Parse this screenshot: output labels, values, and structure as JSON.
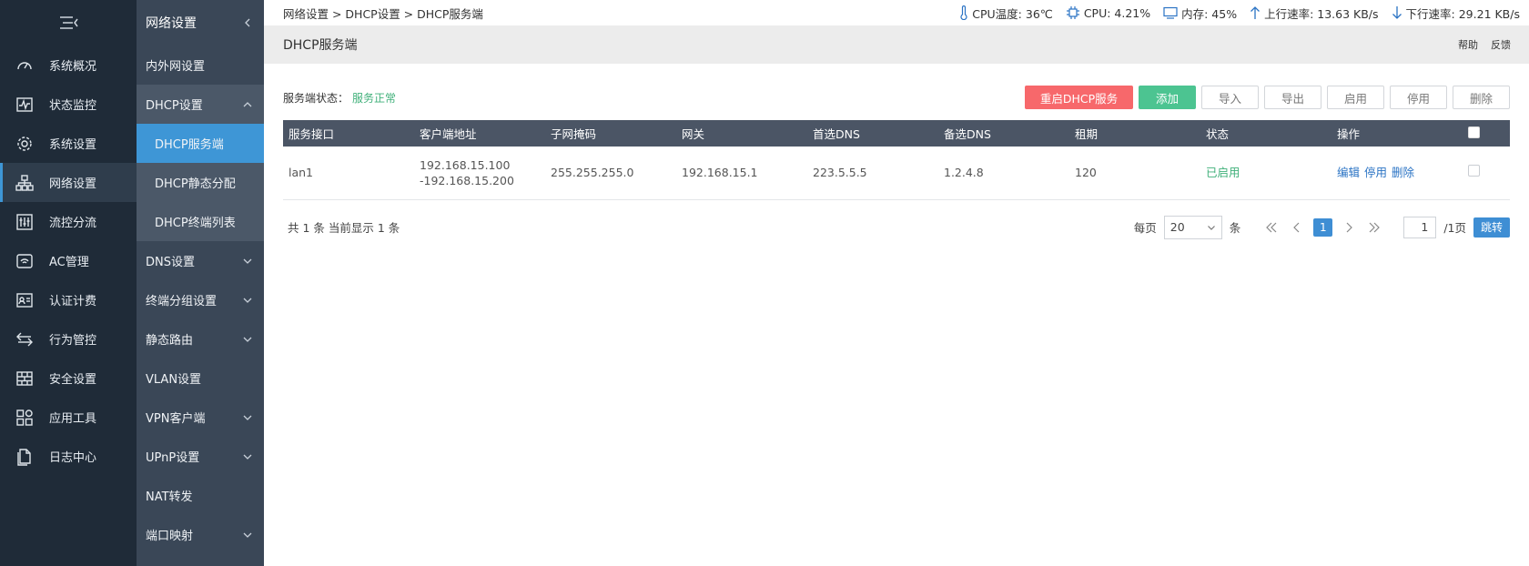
{
  "nav": {
    "items": [
      {
        "label": "系统概况",
        "icon": "gauge-icon"
      },
      {
        "label": "状态监控",
        "icon": "pulse-icon"
      },
      {
        "label": "系统设置",
        "icon": "gear-icon"
      },
      {
        "label": "网络设置",
        "icon": "network-icon"
      },
      {
        "label": "流控分流",
        "icon": "sliders-icon"
      },
      {
        "label": "AC管理",
        "icon": "wifi-icon"
      },
      {
        "label": "认证计费",
        "icon": "id-card-icon"
      },
      {
        "label": "行为管控",
        "icon": "swap-icon"
      },
      {
        "label": "安全设置",
        "icon": "firewall-icon"
      },
      {
        "label": "应用工具",
        "icon": "apps-icon"
      },
      {
        "label": "日志中心",
        "icon": "log-icon"
      }
    ]
  },
  "submenu": {
    "title": "网络设置",
    "items": [
      {
        "label": "内外网设置"
      },
      {
        "label": "DHCP设置"
      },
      {
        "label": "DHCP服务端"
      },
      {
        "label": "DHCP静态分配"
      },
      {
        "label": "DHCP终端列表"
      },
      {
        "label": "DNS设置"
      },
      {
        "label": "终端分组设置"
      },
      {
        "label": "静态路由"
      },
      {
        "label": "VLAN设置"
      },
      {
        "label": "VPN客户端"
      },
      {
        "label": "UPnP设置"
      },
      {
        "label": "NAT转发"
      },
      {
        "label": "端口映射"
      }
    ]
  },
  "breadcrumb": "网络设置 > DHCP设置 > DHCP服务端",
  "stats": {
    "cpu_temp": "CPU温度: 36℃",
    "cpu": "CPU: 4.21%",
    "mem": "内存: 45%",
    "up": "上行速率: 13.63 KB/s",
    "down": "下行速率: 29.21 KB/s"
  },
  "page": {
    "title": "DHCP服务端",
    "help": "帮助",
    "feedback": "反馈"
  },
  "server_status": {
    "label": "服务端状态：",
    "value": "服务正常"
  },
  "toolbar": {
    "restart": "重启DHCP服务",
    "add": "添加",
    "import": "导入",
    "export": "导出",
    "enable": "启用",
    "disable": "停用",
    "delete": "删除"
  },
  "table": {
    "headers": [
      "服务接口",
      "客户端地址",
      "子网掩码",
      "网关",
      "首选DNS",
      "备选DNS",
      "租期",
      "状态",
      "操作"
    ],
    "rows": [
      {
        "iface": "lan1",
        "range_start": "192.168.15.100",
        "range_end": "-192.168.15.200",
        "mask": "255.255.255.0",
        "gateway": "192.168.15.1",
        "dns1": "223.5.5.5",
        "dns2": "1.2.4.8",
        "lease": "120",
        "status": "已启用",
        "op_edit": "编辑",
        "op_disable": "停用",
        "op_delete": "删除"
      }
    ]
  },
  "pager": {
    "summary": "共 1 条 当前显示 1 条",
    "per_page_label": "每页",
    "per_page": "20",
    "unit": "条",
    "current": "1",
    "page_input": "1",
    "total_pages": "/1页",
    "go": "跳转"
  },
  "colors": {
    "nav_bg": "#1f2b38",
    "submenu_bg": "#3a4757",
    "active_blue": "#3e96d6",
    "danger": "#f7686b",
    "success": "#4cc491",
    "status_ok": "#40b07a"
  }
}
